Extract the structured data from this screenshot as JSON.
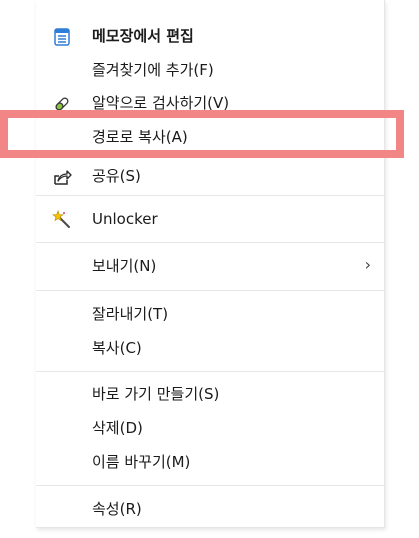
{
  "menu": {
    "items": [
      {
        "label": "메모장에서 편집",
        "icon": "notepad-icon",
        "bold": true
      },
      {
        "label": "즐겨찾기에 추가(F)",
        "icon": "",
        "bold": false
      },
      {
        "label": "알약으로 검사하기(V)",
        "icon": "alyac-scan-icon",
        "bold": false
      },
      {
        "label": "경로로 복사(A)",
        "icon": "",
        "bold": false
      },
      {
        "label": "공유(S)",
        "icon": "share-icon",
        "bold": false
      },
      {
        "label": "Unlocker",
        "icon": "unlocker-wand-icon",
        "bold": false
      },
      {
        "label": "보내기(N)",
        "icon": "",
        "bold": false,
        "submenu_arrow": "›"
      },
      {
        "label": "잘라내기(T)",
        "icon": "",
        "bold": false
      },
      {
        "label": "복사(C)",
        "icon": "",
        "bold": false
      },
      {
        "label": "바로 가기 만들기(S)",
        "icon": "",
        "bold": false
      },
      {
        "label": "삭제(D)",
        "icon": "",
        "bold": false
      },
      {
        "label": "이름 바꾸기(M)",
        "icon": "",
        "bold": false
      },
      {
        "label": "속성(R)",
        "icon": "",
        "bold": false
      }
    ]
  },
  "colors": {
    "highlight_border": "#f28686",
    "notepad_blue": "#2e7dd7",
    "text": "#1b1b1b"
  }
}
